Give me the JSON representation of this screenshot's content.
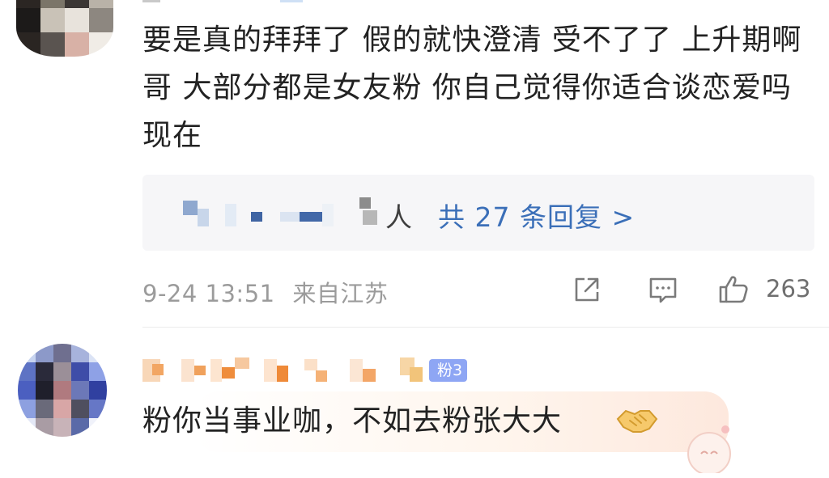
{
  "comment1": {
    "text": "要是真的拜拜了 假的就快澄清 受不了了 上升期啊哥 大部分都是女友粉 你自己觉得你适合谈恋爱吗现在",
    "replies": {
      "suffix": "人",
      "link_text": "共 27 条回复 >"
    },
    "date": "9-24 13:51",
    "location": "来自江苏",
    "like_count": "263",
    "icons": [
      "share-icon",
      "comment-icon",
      "like-icon"
    ]
  },
  "comment2": {
    "badge": "粉3",
    "text": "粉你当事业咖，不如去粉张大大",
    "emoji": "handshake-icon"
  },
  "colors": {
    "link": "#3b6fb8",
    "meta": "#9b9b9b",
    "badge": "#8ea6f4",
    "text": "#222222"
  }
}
